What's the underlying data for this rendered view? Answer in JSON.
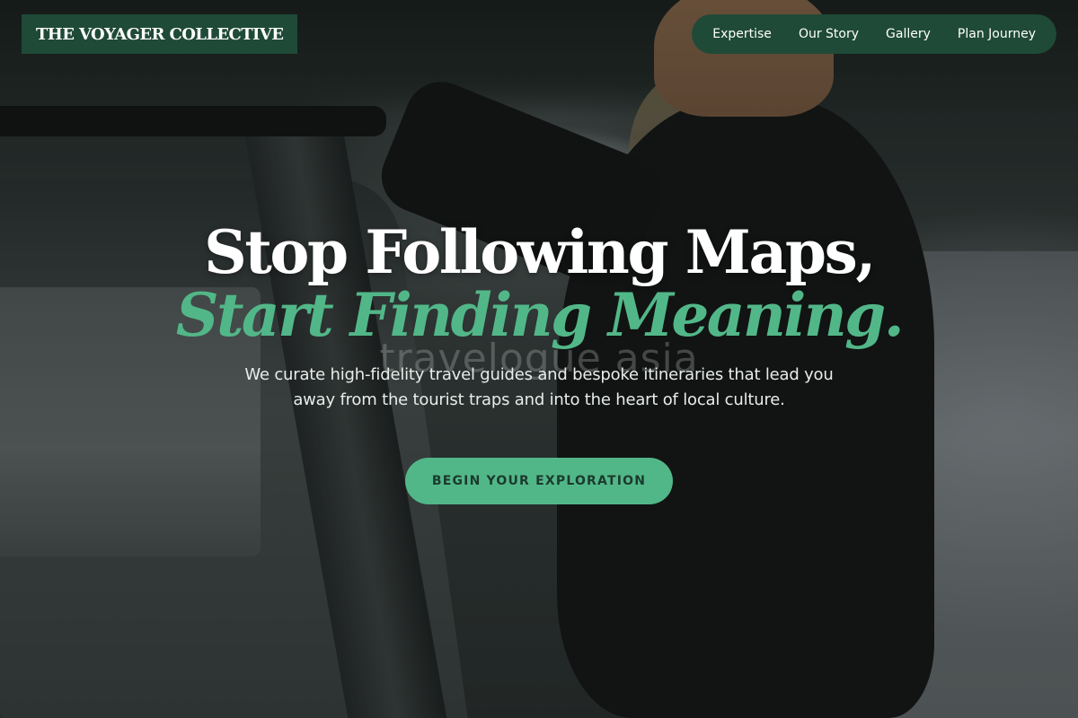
{
  "header": {
    "brand": "THE VOYAGER COLLECTIVE",
    "nav": [
      {
        "label": "Expertise"
      },
      {
        "label": "Our Story"
      },
      {
        "label": "Gallery"
      },
      {
        "label": "Plan Journey"
      }
    ]
  },
  "hero": {
    "headline_line1": "Stop Following Maps,",
    "headline_line2": "Start Finding Meaning.",
    "watermark": "travelogue asia",
    "subtext": "We curate high-fidelity travel guides and bespoke itineraries that lead you away from the tourist traps and into the heart of local culture.",
    "cta_label": "BEGIN YOUR EXPLORATION"
  },
  "colors": {
    "brand_green": "#1f4a37",
    "accent_green": "#52b788",
    "text_light": "#ffffff"
  }
}
